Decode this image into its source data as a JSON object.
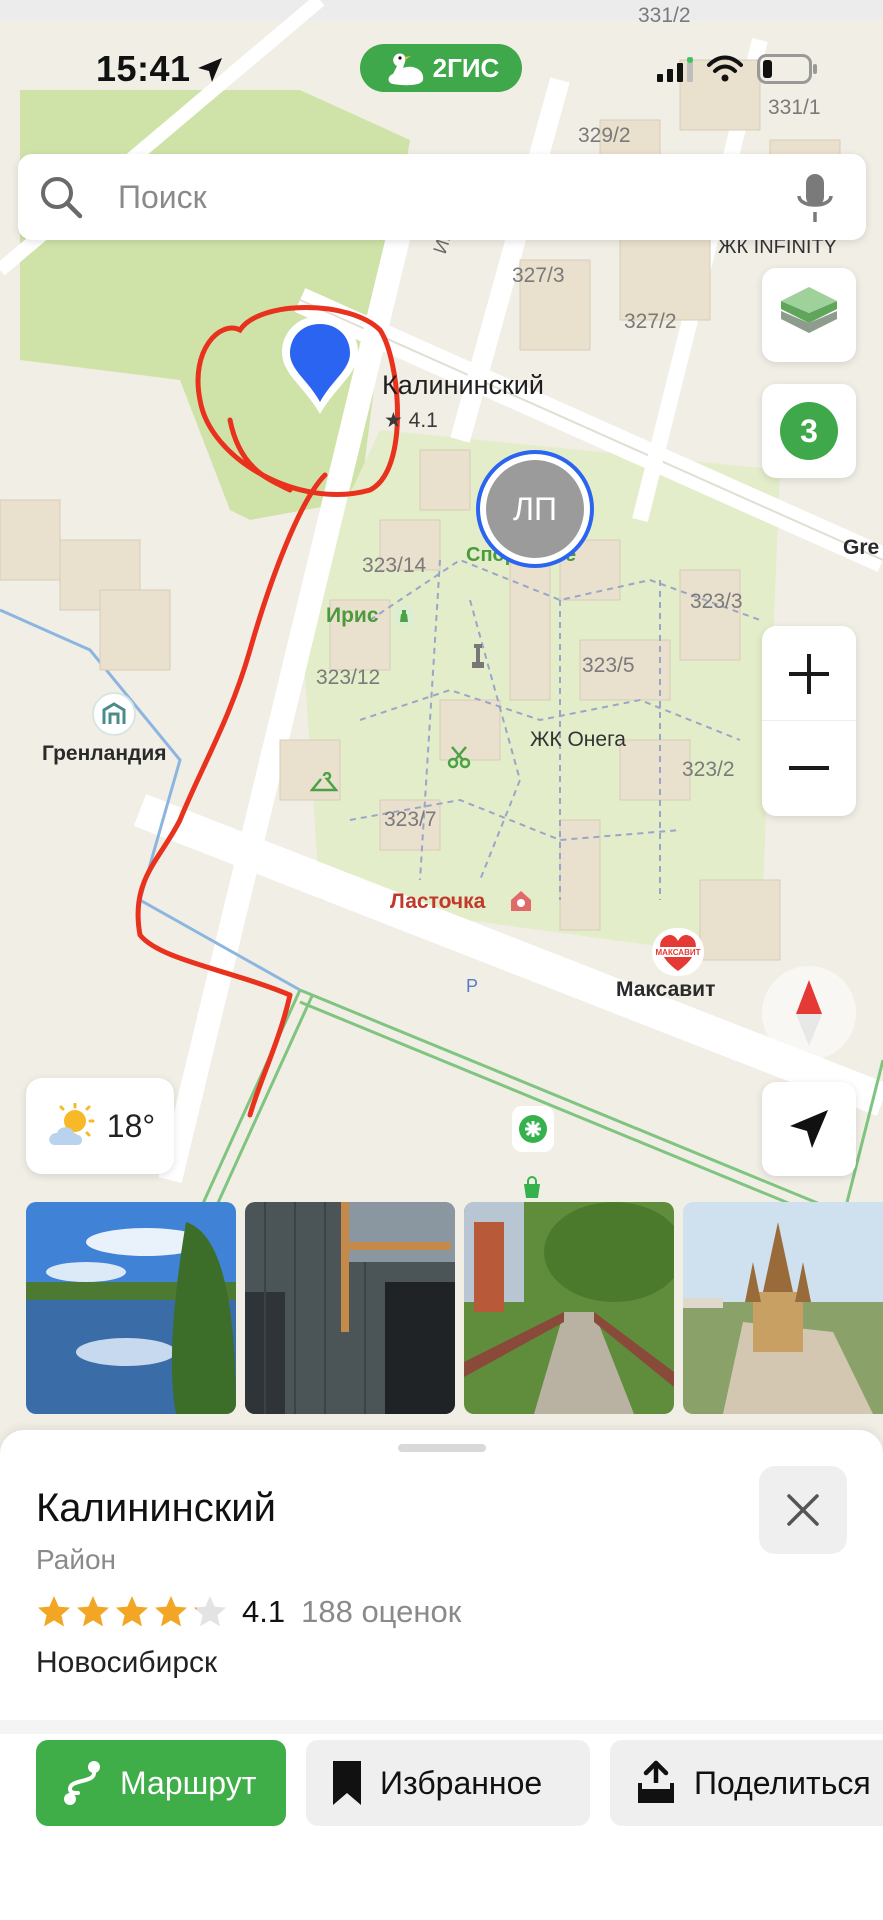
{
  "status_bar": {
    "time": "15:41",
    "app_badge": "2ГИС"
  },
  "search": {
    "placeholder": "Поиск"
  },
  "map": {
    "district": {
      "name": "Калининский",
      "rating": "★ 4.1"
    },
    "user_marker_initials": "ЛП",
    "layers_count": "3",
    "house_numbers": [
      "331/2",
      "331/1",
      "329/2",
      "327/3",
      "327/2",
      "323/14",
      "323/12",
      "323/3",
      "323/5",
      "323/2",
      "323/7"
    ],
    "labels": {
      "infinity": "ЖК INFINITY",
      "igor": "Игор",
      "sport": "Спорт тебе",
      "iris": "Ирис",
      "greenland": "Гренландия",
      "onega": "ЖК Онега",
      "lastochka": "Ласточка",
      "maksavit": "Максавит",
      "maksavit_logo": "МАКСАВИТ",
      "gre": "Gre",
      "parking": "P"
    },
    "weather": {
      "temp": "18°"
    }
  },
  "place_card": {
    "title": "Калининский",
    "type": "Район",
    "rating": "4.1",
    "rating_value": 4.1,
    "reviews": "188 оценок",
    "city": "Новосибирск",
    "actions": {
      "route": "Маршрут",
      "favorites": "Избранное",
      "share": "Поделиться"
    }
  },
  "colors": {
    "accent_green": "#3fae49",
    "marker_blue": "#2a64f0",
    "annotation_red": "#e8321e"
  }
}
